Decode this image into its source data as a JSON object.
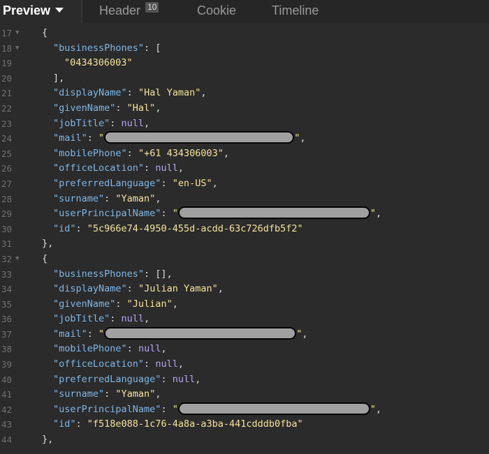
{
  "tabs": {
    "preview": "Preview",
    "header": "Header",
    "header_badge": "10",
    "cookie": "Cookie",
    "timeline": "Timeline"
  },
  "code": {
    "lines": [
      {
        "n": "17",
        "fold": true,
        "indent": 3,
        "tokens": [
          {
            "t": "p",
            "v": "{"
          }
        ]
      },
      {
        "n": "18",
        "fold": true,
        "indent": 4,
        "tokens": [
          {
            "t": "k",
            "v": "\"businessPhones\""
          },
          {
            "t": "p",
            "v": ": ["
          }
        ]
      },
      {
        "n": "19",
        "indent": 5,
        "tokens": [
          {
            "t": "s",
            "v": "\"0434306003\""
          }
        ]
      },
      {
        "n": "20",
        "indent": 4,
        "tokens": [
          {
            "t": "p",
            "v": "],"
          }
        ]
      },
      {
        "n": "21",
        "indent": 4,
        "tokens": [
          {
            "t": "k",
            "v": "\"displayName\""
          },
          {
            "t": "p",
            "v": ": "
          },
          {
            "t": "s",
            "v": "\"Hal Yaman\""
          },
          {
            "t": "p",
            "v": ","
          }
        ]
      },
      {
        "n": "22",
        "indent": 4,
        "tokens": [
          {
            "t": "k",
            "v": "\"givenName\""
          },
          {
            "t": "p",
            "v": ": "
          },
          {
            "t": "s",
            "v": "\"Hal\""
          },
          {
            "t": "p",
            "v": ","
          }
        ]
      },
      {
        "n": "23",
        "indent": 4,
        "tokens": [
          {
            "t": "k",
            "v": "\"jobTitle\""
          },
          {
            "t": "p",
            "v": ": "
          },
          {
            "t": "n",
            "v": "null"
          },
          {
            "t": "p",
            "v": ","
          }
        ]
      },
      {
        "n": "24",
        "indent": 4,
        "tokens": [
          {
            "t": "k",
            "v": "\"mail\""
          },
          {
            "t": "p",
            "v": ": "
          },
          {
            "t": "s",
            "v": "\""
          },
          {
            "t": "r",
            "w": 272
          },
          {
            "t": "s",
            "v": "\""
          },
          {
            "t": "p",
            "v": ","
          }
        ]
      },
      {
        "n": "25",
        "indent": 4,
        "tokens": [
          {
            "t": "k",
            "v": "\"mobilePhone\""
          },
          {
            "t": "p",
            "v": ": "
          },
          {
            "t": "s",
            "v": "\"+61 434306003\""
          },
          {
            "t": "p",
            "v": ","
          }
        ]
      },
      {
        "n": "26",
        "indent": 4,
        "tokens": [
          {
            "t": "k",
            "v": "\"officeLocation\""
          },
          {
            "t": "p",
            "v": ": "
          },
          {
            "t": "n",
            "v": "null"
          },
          {
            "t": "p",
            "v": ","
          }
        ]
      },
      {
        "n": "27",
        "indent": 4,
        "tokens": [
          {
            "t": "k",
            "v": "\"preferredLanguage\""
          },
          {
            "t": "p",
            "v": ": "
          },
          {
            "t": "s",
            "v": "\"en-US\""
          },
          {
            "t": "p",
            "v": ","
          }
        ]
      },
      {
        "n": "28",
        "indent": 4,
        "tokens": [
          {
            "t": "k",
            "v": "\"surname\""
          },
          {
            "t": "p",
            "v": ": "
          },
          {
            "t": "s",
            "v": "\"Yaman\""
          },
          {
            "t": "p",
            "v": ","
          }
        ]
      },
      {
        "n": "29",
        "indent": 4,
        "tokens": [
          {
            "t": "k",
            "v": "\"userPrincipalName\""
          },
          {
            "t": "p",
            "v": ": "
          },
          {
            "t": "s",
            "v": "\""
          },
          {
            "t": "r",
            "w": 275
          },
          {
            "t": "s",
            "v": "\""
          },
          {
            "t": "p",
            "v": ","
          }
        ]
      },
      {
        "n": "30",
        "indent": 4,
        "tokens": [
          {
            "t": "k",
            "v": "\"id\""
          },
          {
            "t": "p",
            "v": ": "
          },
          {
            "t": "s",
            "v": "\"5c966e74-4950-455d-acdd-63c726dfb5f2\""
          }
        ]
      },
      {
        "n": "31",
        "indent": 3,
        "tokens": [
          {
            "t": "p",
            "v": "},"
          }
        ]
      },
      {
        "n": "32",
        "fold": true,
        "indent": 3,
        "tokens": [
          {
            "t": "p",
            "v": "{"
          }
        ]
      },
      {
        "n": "33",
        "indent": 4,
        "tokens": [
          {
            "t": "k",
            "v": "\"businessPhones\""
          },
          {
            "t": "p",
            "v": ": [],"
          }
        ]
      },
      {
        "n": "34",
        "indent": 4,
        "tokens": [
          {
            "t": "k",
            "v": "\"displayName\""
          },
          {
            "t": "p",
            "v": ": "
          },
          {
            "t": "s",
            "v": "\"Julian Yaman\""
          },
          {
            "t": "p",
            "v": ","
          }
        ]
      },
      {
        "n": "35",
        "indent": 4,
        "tokens": [
          {
            "t": "k",
            "v": "\"givenName\""
          },
          {
            "t": "p",
            "v": ": "
          },
          {
            "t": "s",
            "v": "\"Julian\""
          },
          {
            "t": "p",
            "v": ","
          }
        ]
      },
      {
        "n": "36",
        "indent": 4,
        "tokens": [
          {
            "t": "k",
            "v": "\"jobTitle\""
          },
          {
            "t": "p",
            "v": ": "
          },
          {
            "t": "n",
            "v": "null"
          },
          {
            "t": "p",
            "v": ","
          }
        ]
      },
      {
        "n": "37",
        "indent": 4,
        "tokens": [
          {
            "t": "k",
            "v": "\"mail\""
          },
          {
            "t": "p",
            "v": ": "
          },
          {
            "t": "s",
            "v": "\""
          },
          {
            "t": "r",
            "w": 275
          },
          {
            "t": "s",
            "v": "\""
          },
          {
            "t": "p",
            "v": ","
          }
        ]
      },
      {
        "n": "38",
        "indent": 4,
        "tokens": [
          {
            "t": "k",
            "v": "\"mobilePhone\""
          },
          {
            "t": "p",
            "v": ": "
          },
          {
            "t": "n",
            "v": "null"
          },
          {
            "t": "p",
            "v": ","
          }
        ]
      },
      {
        "n": "39",
        "indent": 4,
        "tokens": [
          {
            "t": "k",
            "v": "\"officeLocation\""
          },
          {
            "t": "p",
            "v": ": "
          },
          {
            "t": "n",
            "v": "null"
          },
          {
            "t": "p",
            "v": ","
          }
        ]
      },
      {
        "n": "40",
        "indent": 4,
        "tokens": [
          {
            "t": "k",
            "v": "\"preferredLanguage\""
          },
          {
            "t": "p",
            "v": ": "
          },
          {
            "t": "n",
            "v": "null"
          },
          {
            "t": "p",
            "v": ","
          }
        ]
      },
      {
        "n": "41",
        "indent": 4,
        "tokens": [
          {
            "t": "k",
            "v": "\"surname\""
          },
          {
            "t": "p",
            "v": ": "
          },
          {
            "t": "s",
            "v": "\"Yaman\""
          },
          {
            "t": "p",
            "v": ","
          }
        ]
      },
      {
        "n": "42",
        "indent": 4,
        "tokens": [
          {
            "t": "k",
            "v": "\"userPrincipalName\""
          },
          {
            "t": "p",
            "v": ": "
          },
          {
            "t": "s",
            "v": "\""
          },
          {
            "t": "r",
            "w": 275
          },
          {
            "t": "s",
            "v": "\""
          },
          {
            "t": "p",
            "v": ","
          }
        ]
      },
      {
        "n": "43",
        "indent": 4,
        "tokens": [
          {
            "t": "k",
            "v": "\"id\""
          },
          {
            "t": "p",
            "v": ": "
          },
          {
            "t": "s",
            "v": "\"f518e088-1c76-4a8a-a3ba-441cdddb0fba\""
          }
        ]
      },
      {
        "n": "44",
        "indent": 3,
        "tokens": [
          {
            "t": "p",
            "v": "},"
          }
        ]
      }
    ]
  }
}
